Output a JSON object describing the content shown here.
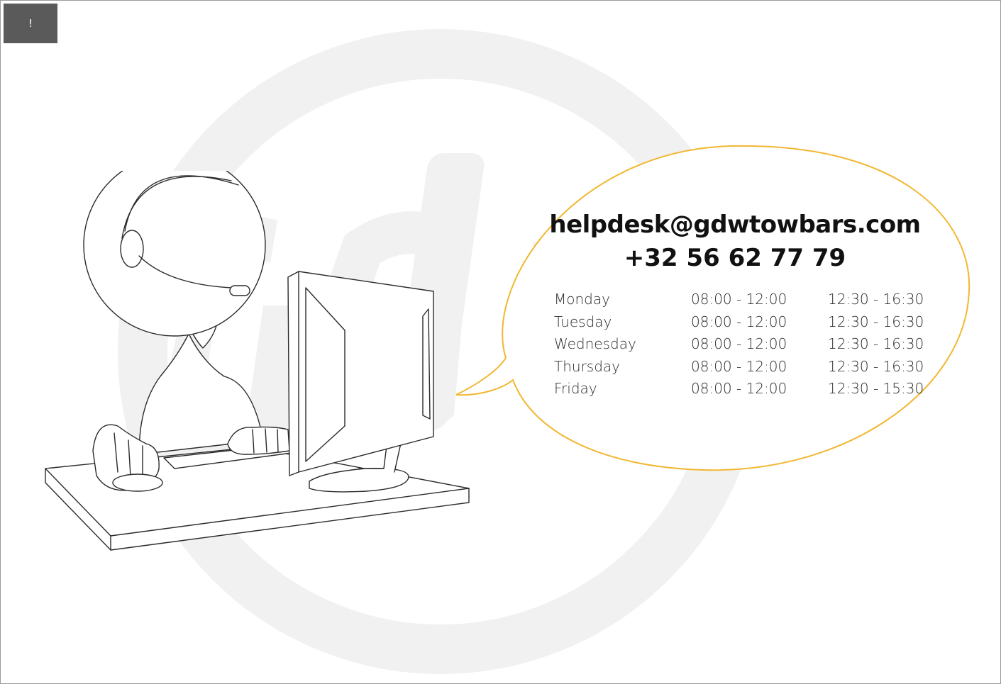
{
  "alert": {
    "icon": "exclamation-icon",
    "label": "!"
  },
  "contact": {
    "email": "helpdesk@gdwtowbars.com",
    "phone": "+32 56 62 77 79"
  },
  "opening_hours": [
    {
      "day": "Monday",
      "morning": "08:00 - 12:00",
      "afternoon": "12:30 - 16:30"
    },
    {
      "day": "Tuesday",
      "morning": "08:00 - 12:00",
      "afternoon": "12:30 - 16:30"
    },
    {
      "day": "Wednesday",
      "morning": "08:00 - 12:00",
      "afternoon": "12:30 - 16:30"
    },
    {
      "day": "Thursday",
      "morning": "08:00 - 12:00",
      "afternoon": "12:30 - 16:30"
    },
    {
      "day": "Friday",
      "morning": "08:00 - 12:00",
      "afternoon": "12:30 - 15:30"
    }
  ],
  "colors": {
    "bubble_outline": "#f2b731",
    "watermark": "#f1f1f1",
    "alert_bg": "#5a5a5a",
    "text": "#111111"
  }
}
